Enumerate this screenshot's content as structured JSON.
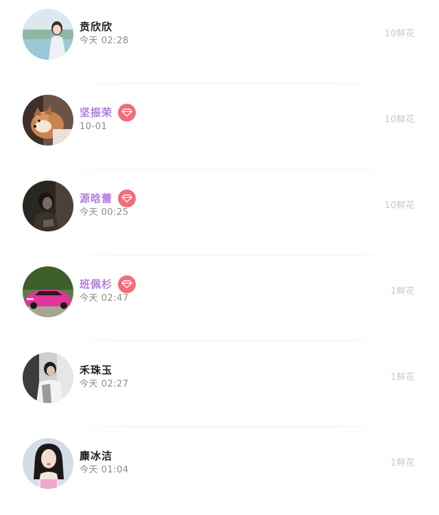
{
  "records": [
    {
      "name": "贲欣欣",
      "time": "今天 02:28",
      "flowers": "10鲜花",
      "vip": false,
      "avatar": "woman-lakeside-photo"
    },
    {
      "name": "坚振荣",
      "time": "10-01",
      "flowers": "10鲜花",
      "vip": true,
      "avatar": "shiba-dog-photo"
    },
    {
      "name": "源晗蕾",
      "time": "今天 00:25",
      "flowers": "10鲜花",
      "vip": true,
      "avatar": "dark-portrait-photo"
    },
    {
      "name": "班佩杉",
      "time": "今天 02:47",
      "flowers": "1鲜花",
      "vip": true,
      "avatar": "pink-sports-car-photo"
    },
    {
      "name": "禾珠玉",
      "time": "今天 02:27",
      "flowers": "1鲜花",
      "vip": false,
      "avatar": "man-indoor-photo"
    },
    {
      "name": "麋冰洁",
      "time": "今天 01:04",
      "flowers": "1鲜花",
      "vip": false,
      "avatar": "woman-portrait-photo"
    }
  ],
  "colors": {
    "name_default": "#1e1e1e",
    "name_vip": "#b27ee0",
    "vip_badge": "#f56b78",
    "time_text": "#8a8a8a",
    "flowers_text": "#c8c8c8"
  },
  "icons": {
    "vip_badge": "diamond-icon"
  }
}
